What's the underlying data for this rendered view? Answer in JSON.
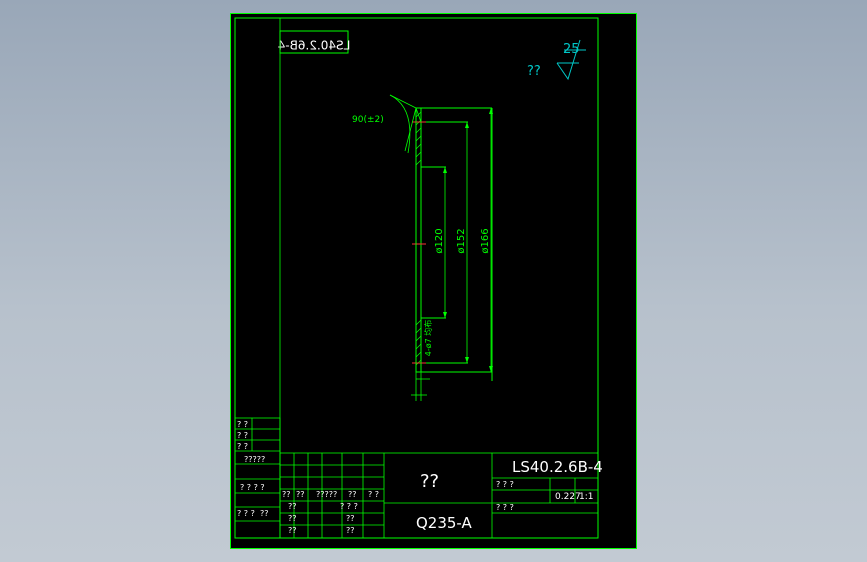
{
  "viewer": {
    "background_top": "#99a7b8",
    "background_bottom": "#c2cad3"
  },
  "colors": {
    "sheet": "#000000",
    "border": "#00ff00",
    "title_block_lines": "#00ff00",
    "part_lines": "#00ff00",
    "dimension": "#00ff00",
    "centerline": "#ff3333",
    "annotation_cyan": "#00c8c8",
    "text_white": "#ffffff"
  },
  "drawing": {
    "mirror_code": "LS40.2.6B-4",
    "roughness_value": "25",
    "roughness_note": "??",
    "dims": {
      "angle": "90(±2)",
      "d120": "ø120",
      "d152": "ø152",
      "d166": "ø166",
      "holes": "4-ø7 均布"
    }
  },
  "title_block": {
    "part_name": "??",
    "drawing_code": "LS40.2.6B-4",
    "material": "Q235-A",
    "scale": "1:1",
    "weight": "0.227",
    "stage_label": "? ? ?",
    "sheet_label": "? ? ?",
    "fill_q": "??",
    "fill_q2": "? ?",
    "fill_q3": "? ? ?",
    "fill_q4": "? ? ? ?",
    "fill_q5": "????",
    "fill_q6": "?????"
  }
}
